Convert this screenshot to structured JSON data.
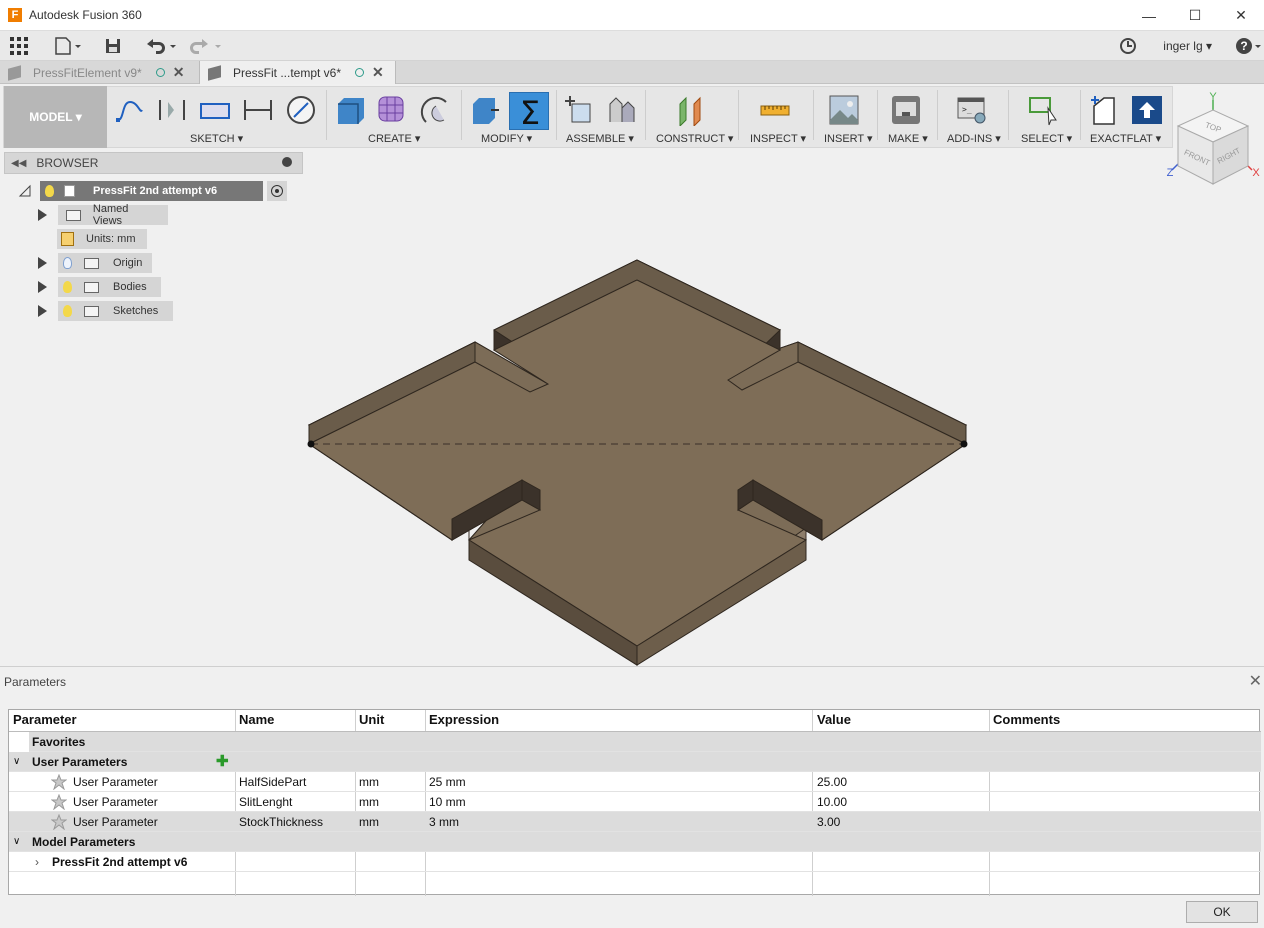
{
  "window": {
    "title": "Autodesk Fusion 360"
  },
  "quickbar": {
    "user": "inger lg ▾"
  },
  "tabs": [
    {
      "label": "PressFitElement v9*"
    },
    {
      "label": "PressFit ...tempt v6*"
    }
  ],
  "ribbon": {
    "workspace": "MODEL ▾",
    "groups": {
      "sketch": "SKETCH ▾",
      "create": "CREATE ▾",
      "modify": "MODIFY ▾",
      "assemble": "ASSEMBLE ▾",
      "construct": "CONSTRUCT ▾",
      "inspect": "INSPECT ▾",
      "insert": "INSERT ▾",
      "make": "MAKE ▾",
      "addins": "ADD-INS ▾",
      "select": "SELECT ▾",
      "exactflat": "EXACTFLAT ▾"
    }
  },
  "browser": {
    "title": "BROWSER",
    "root": "PressFit 2nd attempt v6",
    "items": {
      "named_views": "Named Views",
      "units": "Units: mm",
      "origin": "Origin",
      "bodies": "Bodies",
      "sketches": "Sketches"
    }
  },
  "viewcube": {
    "top": "TOP",
    "front": "FRONT",
    "right": "RIGHT",
    "axis_x": "X",
    "axis_y": "Y",
    "axis_z": "Z"
  },
  "parameters": {
    "title": "Parameters",
    "headers": {
      "parameter": "Parameter",
      "name": "Name",
      "unit": "Unit",
      "expression": "Expression",
      "value": "Value",
      "comments": "Comments"
    },
    "favorites": "Favorites",
    "user_section": "User Parameters",
    "user_rows": [
      {
        "parameter": "User Parameter",
        "name": "HalfSidePart",
        "unit": "mm",
        "expression": "25 mm",
        "value": "25.00"
      },
      {
        "parameter": "User Parameter",
        "name": "SlitLenght",
        "unit": "mm",
        "expression": "10 mm",
        "value": "10.00"
      },
      {
        "parameter": "User Parameter",
        "name": "StockThickness",
        "unit": "mm",
        "expression": "3 mm",
        "value": "3.00"
      }
    ],
    "model_section": "Model Parameters",
    "model_child": "PressFit 2nd attempt v6",
    "ok": "OK"
  }
}
